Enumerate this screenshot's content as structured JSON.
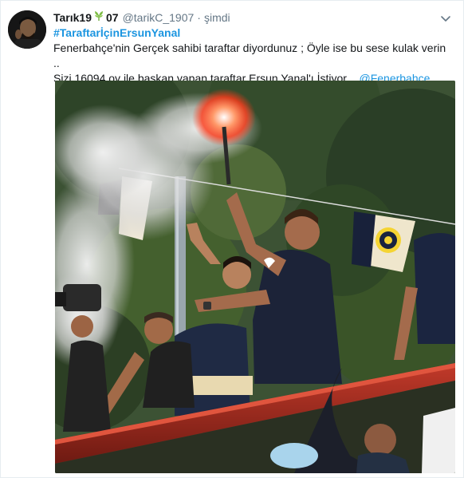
{
  "tweet": {
    "display_name": "Tarık19",
    "name_emoji": "leaf-emoji",
    "name_suffix": "07",
    "handle": "@tarikC_1907",
    "separator": "·",
    "timestamp": "şimdi",
    "hashtag": "#TaraftarİçinErsunYanal",
    "line1": "Fenerbahçe'nin Gerçek sahibi taraftar diyordunuz ; Öyle ise bu sese kulak verin ..",
    "line2": "Sizi 16094 oy ile başkan yapan taraftar Ersun Yanal'ı İstiyor .. ",
    "mention": "@Fenerbahce"
  },
  "icons": {
    "more": "chevron-down-icon",
    "avatar": "user-avatar"
  },
  "colors": {
    "link": "#1b95e0",
    "text": "#14171a",
    "muted": "#657786",
    "border": "#e6ecf0",
    "flare": "#ff3a1a"
  }
}
